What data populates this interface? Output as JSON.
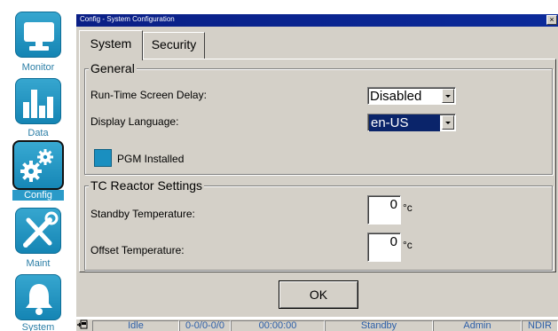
{
  "nav": {
    "items": [
      {
        "label": "Monitor",
        "icon": "monitor-icon"
      },
      {
        "label": "Data",
        "icon": "bar-chart-icon"
      },
      {
        "label": "Config",
        "icon": "gears-icon",
        "active": true
      },
      {
        "label": "Maint",
        "icon": "tools-icon"
      },
      {
        "label": "System",
        "icon": "bell-icon"
      }
    ]
  },
  "dialog": {
    "title": "Config - System Configuration",
    "close_label": "×",
    "tabs": [
      {
        "label": "System",
        "selected": true
      },
      {
        "label": "Security",
        "selected": false
      }
    ],
    "general": {
      "title": "General",
      "screen_delay_label": "Run-Time Screen Delay:",
      "screen_delay_value": "Disabled",
      "language_label": "Display Language:",
      "language_value": "en-US",
      "pgm_label": "PGM Installed"
    },
    "tc_reactor": {
      "title": "TC Reactor Settings",
      "standby_label": "Standby Temperature:",
      "standby_value": "0",
      "standby_unit": "°c",
      "offset_label": "Offset Temperature:",
      "offset_value": "0",
      "offset_unit": "°c"
    },
    "ok_label": "OK"
  },
  "statusbar": {
    "icon": "connection-icon",
    "cells": [
      "Idle",
      "0-0/0-0/0",
      "00:00:00",
      "Standby",
      "Admin",
      "NDIR"
    ]
  },
  "colors": {
    "nav_accent": "#1a8fc0",
    "titlebar": "#0a1f86",
    "dialog_bg": "#d4d0c8",
    "status_text": "#2b5ea8"
  }
}
